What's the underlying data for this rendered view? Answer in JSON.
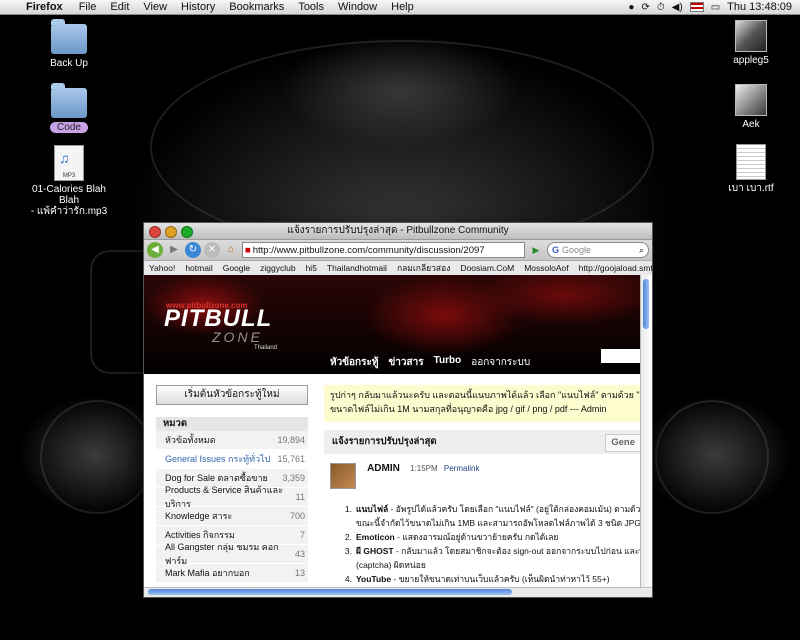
{
  "menubar": {
    "app": "Firefox",
    "menus": [
      "File",
      "Edit",
      "View",
      "History",
      "Bookmarks",
      "Tools",
      "Window",
      "Help"
    ],
    "clock": "Thu 13:48:09"
  },
  "desktop_icons": {
    "backup": "Back Up",
    "code": "Code",
    "mp3_line1": "01-Calories Blah Blah",
    "mp3_line2": "- แพ้คำว่ารัก.mp3",
    "mp3_badge": "MP3",
    "appleg5": "appleg5",
    "aek": "Aek",
    "rtf": "เบา เบา.rtf"
  },
  "browser": {
    "window_title": "แจ้งรายการปรับปรุงล่าสุด - Pitbullzone Community",
    "url": "http://www.pitbullzone.com/community/discussion/2097",
    "search_placeholder": "Google",
    "bookmarks": [
      "Yahoo!",
      "hotmail",
      "Google",
      "ziggyclub",
      "hi5",
      "Thailandhotmail",
      "กลมเกลียวสอง",
      "Doosiam.CoM",
      "MossoloAof",
      "http://goojaload.smf..."
    ]
  },
  "site": {
    "banner_url": "www.pitbullzone.com",
    "logo": "PITBULL",
    "logo_sub": "ZONE",
    "logo_country": "Thailand",
    "nav": [
      "หัวข้อกระทู้",
      "ข่าวสาร",
      "Turbo",
      "ออกจากระบบ"
    ],
    "new_topic_button": "เริ่มต้นหัวข้อกระทู้ใหม่",
    "categories_heading": "หมวด",
    "categories": [
      {
        "name": "หัวข้อทั้งหมด",
        "count": "19,894"
      },
      {
        "name": "General Issues กระทู้ทั่วไป",
        "count": "15,761"
      },
      {
        "name": "Dog for Sale ตลาดซื้อขาย",
        "count": "3,359"
      },
      {
        "name": "Products & Service สินค้าและบริการ",
        "count": "11"
      },
      {
        "name": "Knowledge สาระ",
        "count": "700"
      },
      {
        "name": "Activities กิจกรรม",
        "count": "7"
      },
      {
        "name": "All Gangster กลุ่ม ชมรม คอก ฟาร์ม",
        "count": "43"
      },
      {
        "name": "Mark Mafia อยากบอก",
        "count": "13"
      }
    ],
    "notice_line1": "รูปก่าๆ กลับมาแล้วนะครับ และตอนนี้แนบภาพได้แล้ว เลือก \"แนบไฟล์\" ตามด้วย \"แทรกภาพ\"",
    "notice_line2": "ขนาดไฟล์ไม่เกิน 1M นามสกุลที่อนุญาตคือ jpg / gif / png / pdf --- Admin",
    "discussion_title": "แจ้งรายการปรับปรุงล่าสุด",
    "general_button": "Gene",
    "post": {
      "author": "ADMIN",
      "time": "1:15PM",
      "permalink": "Permalink",
      "items": [
        {
          "num": "1.",
          "bold": "แนบไฟล์",
          "text": " - อัพรูปได้แล้วครับ โดยเลือก \"แนบไฟล์\" (อยู่ใต้กล่องคอมเม้น) ตามด้วย \"แท"
        },
        {
          "num": "",
          "bold": "",
          "text": "ขณะนี้จำกัดไว้ขนาดไม่เกิน 1MB และสามารถอัพโหลดไฟล์ภาพได้ 3 ชนิด JPG GIF PNG"
        },
        {
          "num": "2.",
          "bold": "Emoticon",
          "text": " - แสดงอารมณ์อยู่ด้านขวาย้ายครับ กดได้เลย"
        },
        {
          "num": "3.",
          "bold": "ผี GHOST",
          "text": " - กลับมาแล้ว โดยสมาชิกจะต้อง sign-out ออกจากระบบไปก่อน และพิมพ์ c"
        },
        {
          "num": "",
          "bold": "",
          "text": "(captcha) ผิดหน่อย"
        },
        {
          "num": "4.",
          "bold": "YouTube",
          "text": " - ขยายให้ขนาดเท่าบนเว็บแล้วครับ (เห็นผิดนำท่าหาไว้ 55+)"
        }
      ]
    }
  },
  "colors": {
    "accent_blue": "#4f86d8",
    "link_blue": "#3366aa",
    "notice_yellow": "#fdfccf",
    "banner_red": "#8a0d0d"
  }
}
